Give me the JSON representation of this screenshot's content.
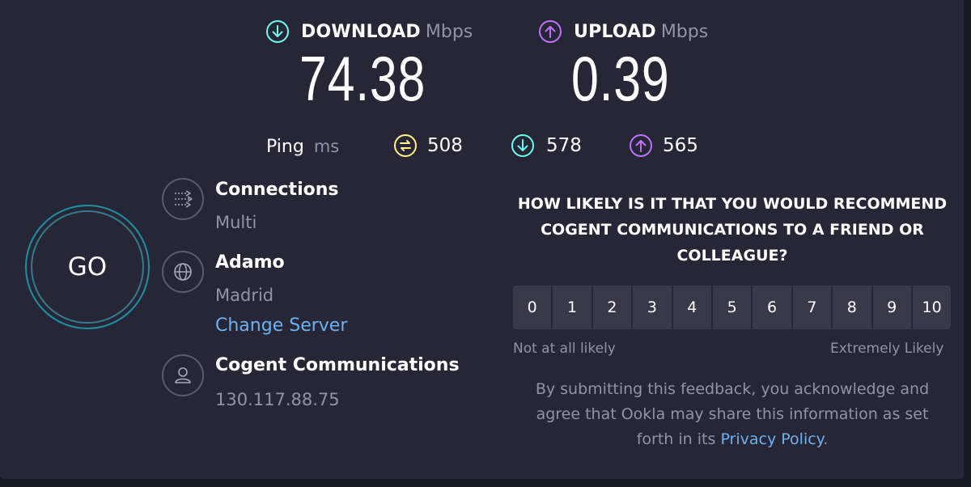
{
  "download": {
    "label": "DOWNLOAD",
    "unit": "Mbps",
    "value": "74.38",
    "color": "#6afff3"
  },
  "upload": {
    "label": "UPLOAD",
    "unit": "Mbps",
    "value": "0.39",
    "color": "#bf71ff"
  },
  "ping": {
    "label": "Ping",
    "unit": "ms",
    "idle": "508",
    "download": "578",
    "upload": "565",
    "idle_color": "#fff38a"
  },
  "go_button": {
    "label": "GO"
  },
  "connections": {
    "title": "Connections",
    "value": "Multi",
    "icon": "connections-icon"
  },
  "server": {
    "title": "Adamo",
    "location": "Madrid",
    "change_label": "Change Server",
    "icon": "globe-icon"
  },
  "provider": {
    "title": "Cogent Communications",
    "ip": "130.117.88.75",
    "icon": "user-icon"
  },
  "survey": {
    "question": "HOW LIKELY IS IT THAT YOU WOULD RECOMMEND COGENT COMMUNICATIONS TO A FRIEND OR COLLEAGUE?",
    "scale": [
      "0",
      "1",
      "2",
      "3",
      "4",
      "5",
      "6",
      "7",
      "8",
      "9",
      "10"
    ],
    "low_hint": "Not at all likely",
    "high_hint": "Extremely Likely",
    "disclaimer": "By submitting this feedback, you acknowledge and agree that Ookla may share this information as set forth in its",
    "privacy_link": "Privacy Policy",
    "disclaimer_end": "."
  }
}
